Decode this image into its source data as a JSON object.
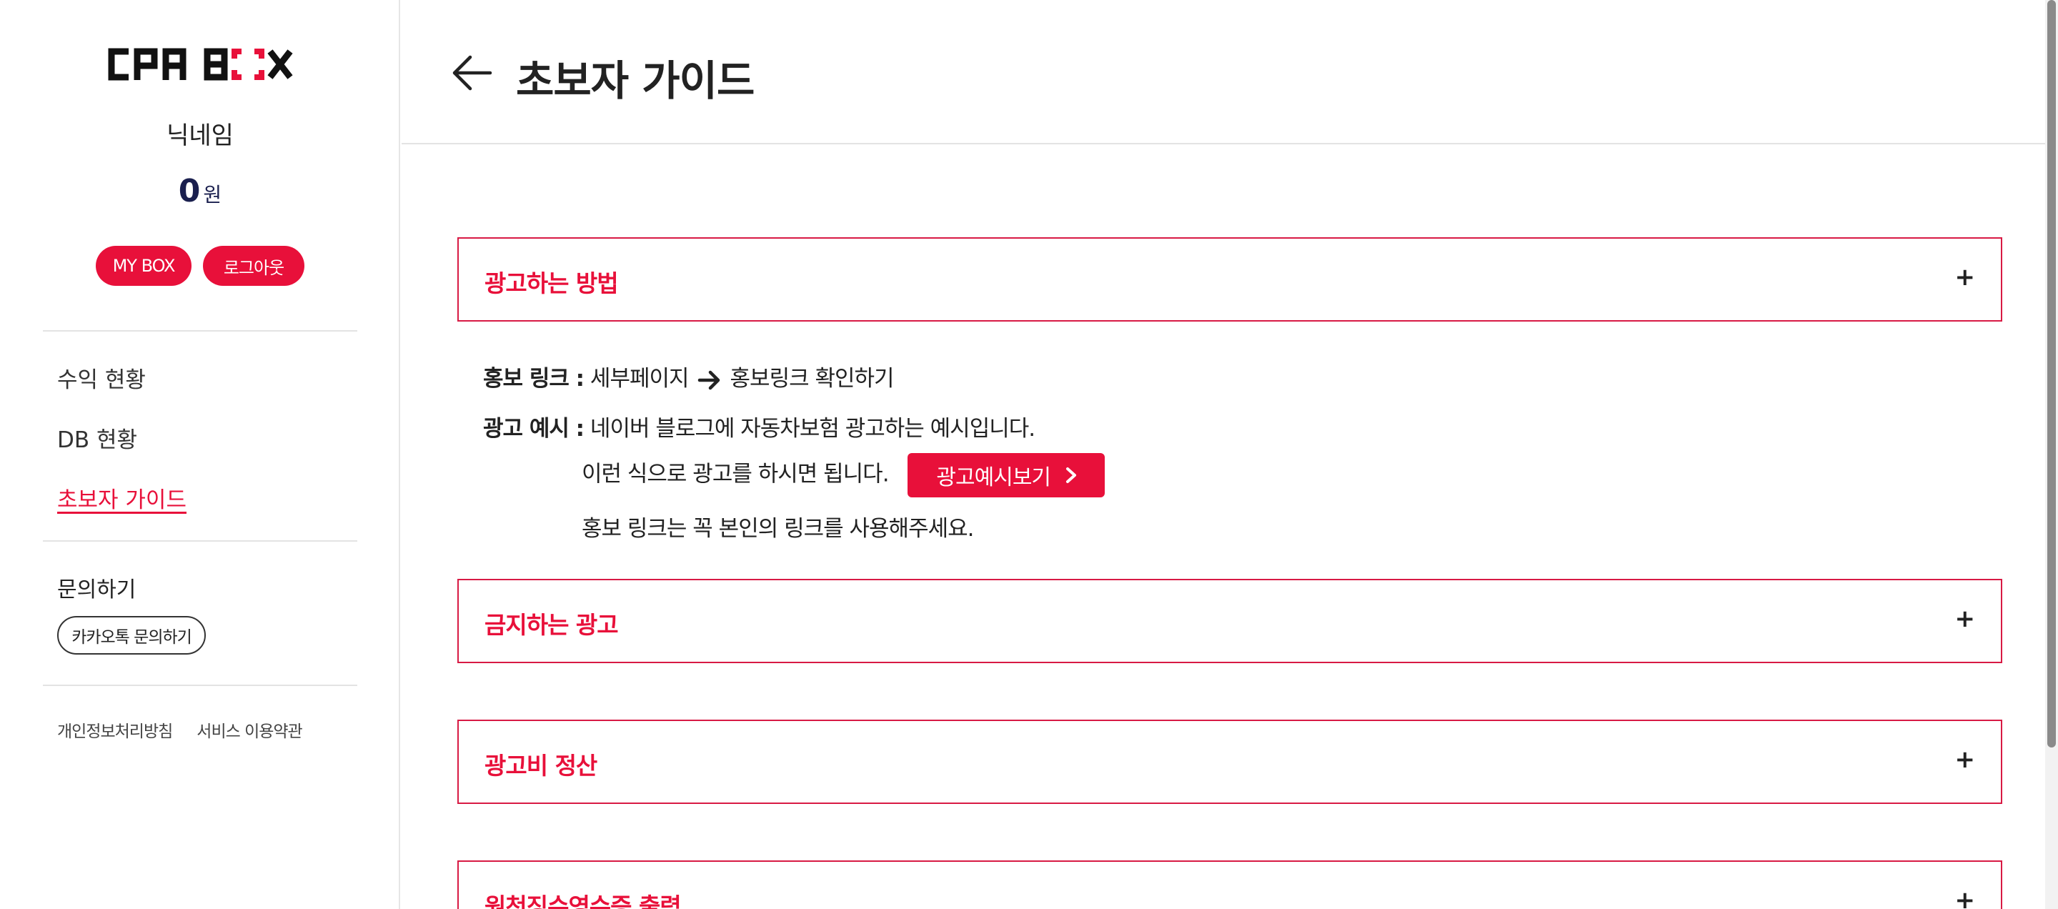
{
  "sidebar": {
    "logo_text": "CPA BOX",
    "nickname": "닉네임",
    "balance_amount": "0",
    "balance_unit": "원",
    "mybox_label": "MY BOX",
    "logout_label": "로그아웃",
    "nav": [
      {
        "label": "수익 현황"
      },
      {
        "label": "DB 현황"
      },
      {
        "label": "초보자 가이드",
        "active": true
      }
    ],
    "inquiry_label": "문의하기",
    "kakao_label": "카카오톡 문의하기",
    "footer_links": [
      "개인정보처리방침",
      "서비스 이용약관"
    ]
  },
  "header": {
    "title": "초보자 가이드"
  },
  "accordion": [
    {
      "title": "광고하는 방법",
      "expanded": true,
      "content": {
        "promo_label": "홍보 링크 :",
        "promo_from": "세부페이지",
        "promo_to": "홍보링크 확인하기",
        "example_label": "광고 예시 :",
        "example_text": "네이버 블로그에 자동차보험 광고하는 예시입니다.",
        "howto_text": "이런 식으로 광고를 하시면 됩니다.",
        "preview_button": "광고예시보기",
        "note_text": "홍보 링크는 꼭 본인의 링크를 사용해주세요."
      }
    },
    {
      "title": "금지하는 광고",
      "expanded": false
    },
    {
      "title": "광고비 정산",
      "expanded": false
    },
    {
      "title": "원천징수영수증 출력",
      "expanded": false
    }
  ],
  "icons": {
    "expand": "+",
    "back": "arrow-left-icon",
    "inline_arrow": "arrow-right-icon",
    "chevron": "chevron-right-icon"
  },
  "colors": {
    "accent": "#e8103a",
    "accordion_border": "#d81a44",
    "balance": "#1a1f4e"
  }
}
